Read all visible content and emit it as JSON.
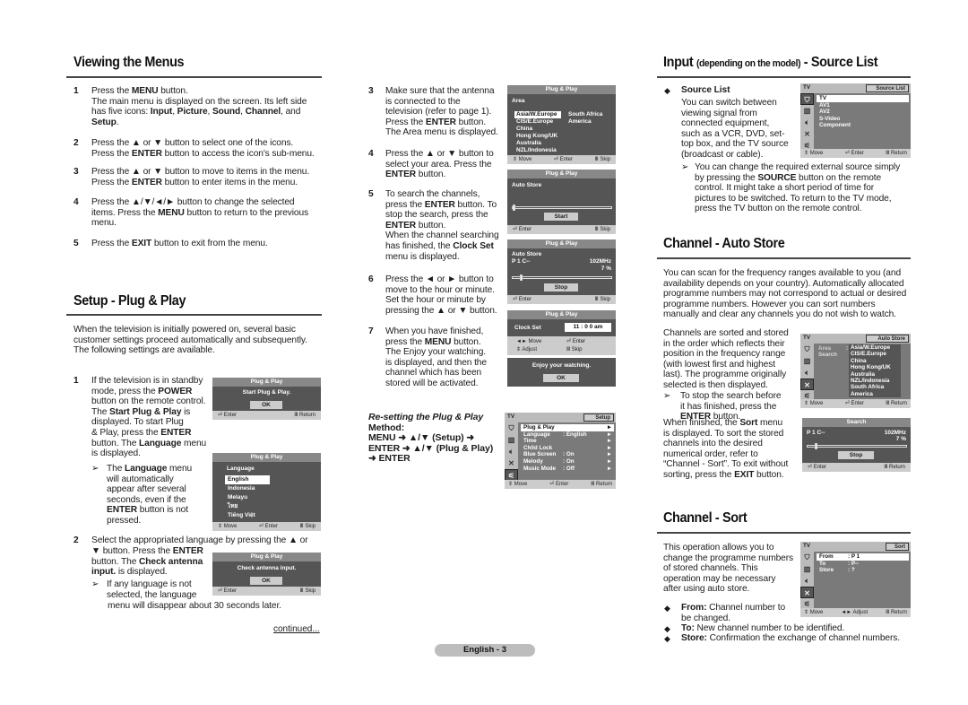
{
  "sections": {
    "viewing": {
      "title": "Viewing the Menus",
      "steps": [
        {
          "n": "1",
          "lines": [
            "Press the <b>MENU</b> button.",
            "The main menu is displayed on the screen. Its left side",
            "has five icons: <b>Input</b>, <b>Picture</b>, <b>Sound</b>, <b>Channel</b>, and",
            "<b>Setup</b>."
          ]
        },
        {
          "n": "2",
          "lines": [
            "Press the ▲ or ▼ button to select one of the icons.",
            "Press the <b>ENTER</b> button to access the icon's sub-menu."
          ]
        },
        {
          "n": "3",
          "lines": [
            "Press the ▲ or ▼ button to move to items in the menu.",
            "Press the <b>ENTER</b> button to enter items in the menu."
          ]
        },
        {
          "n": "4",
          "lines": [
            "Press the ▲/▼/◄/► button to change the selected",
            "items. Press the <b>MENU</b> button to return to the previous",
            "menu."
          ]
        },
        {
          "n": "5",
          "lines": [
            "Press the <b>EXIT</b> button to exit from the menu."
          ]
        }
      ]
    },
    "plug": {
      "title": "Setup - Plug & Play",
      "intro": [
        "When the television is initially powered on, several basic",
        "customer settings proceed automatically and subsequently.",
        "The following settings are available."
      ],
      "step1_num": "1",
      "step1": [
        "If the television is in standby",
        "mode, press the <b>POWER</b>",
        "button on the remote control.",
        "The <b>Start Plug &amp; Play</b> is",
        "displayed. To start Plug",
        "&amp; Play, press the <b>ENTER</b>",
        "button. The <b>Language</b> menu",
        "is displayed."
      ],
      "step1_note": [
        "The <b>Language</b> menu",
        "will automatically",
        "appear after several",
        "seconds, even if the",
        "<b>ENTER</b> button is not",
        "pressed."
      ],
      "step2_num": "2",
      "step2_first": "Select the appropriated language by pressing the ▲ or",
      "step2": [
        "▼ button. Press the <b>ENTER</b>",
        "button. The <b>Check antenna</b>",
        "<b>input.</b> is displayed."
      ],
      "step2_note": [
        "If any language is not",
        "selected, the language"
      ],
      "step2_tail": "menu will disappear about 30 seconds later.",
      "continued": "continued...",
      "step3_num": "3",
      "step3": [
        "Make sure that the antenna",
        "is connected to the",
        "television (refer to page 1).",
        "Press the <b>ENTER</b> button.",
        "The Area menu is displayed."
      ],
      "step4_num": "4",
      "step4": [
        "Press the ▲ or ▼ button to",
        "select your area. Press the",
        "<b>ENTER</b> button."
      ],
      "step5_num": "5",
      "step5": [
        "To search the channels,",
        "press the <b>ENTER</b> button. To",
        "stop the search, press the",
        "<b>ENTER</b> button.",
        "When the channel searching",
        "has finished, the <b>Clock Set</b>",
        "menu is displayed."
      ],
      "step6_num": "6",
      "step6": [
        "Press the ◄ or ► button to",
        "move to the hour or minute.",
        "Set the hour or minute by",
        "pressing the ▲ or ▼ button."
      ],
      "step7_num": "7",
      "step7": [
        "When you have finished,",
        "press the <b>MENU</b> button.",
        "The Enjoy your watching.",
        "is displayed, and then the",
        "channel which has been",
        "stored will be activated."
      ],
      "reset": [
        "<i>Re-setting the Plug &amp; Play</i>",
        "Method:",
        "MENU ➜ ▲/▼ (Setup) ➜",
        "ENTER ➜ ▲/▼ (Plug &amp; Play)",
        "➜ ENTER"
      ]
    },
    "source": {
      "title_main": "Input",
      "title_small": "(depending on the model)",
      "title_tail": "- Source List",
      "bullet_title": "Source List",
      "body": [
        "You can switch between",
        "viewing signal from",
        "connected equipment,",
        "such as a VCR, DVD, set-",
        "top box, and the TV source",
        "(broadcast or cable)."
      ],
      "note": [
        "You can change the required external source simply",
        "by pressing the <b>SOURCE</b> button on the remote",
        "control. It might take a short period of time for",
        "pictures to be switched. To return to the TV mode,",
        "press the TV button on the remote control."
      ]
    },
    "autostore": {
      "title": "Channel - Auto Store",
      "intro": [
        "You can scan for the frequency ranges available to you (and",
        "availability depends on your country). Automatically allocated",
        "programme numbers may not correspond to actual or desired",
        "programme numbers. However you can sort numbers",
        "manually and clear any channels you do not wish to watch."
      ],
      "body": [
        "Channels are sorted and stored",
        "in the order which reflects their",
        "position in the frequency range",
        "(with lowest first and highest",
        "last). The programme originally",
        "selected is then displayed."
      ],
      "note": [
        "To stop the search before",
        "it has finished, press the",
        "<b>ENTER</b> button."
      ],
      "tail": [
        "When finished, the <b>Sort</b> menu",
        "is displayed. To sort the stored",
        "channels into the desired",
        "numerical order, refer to",
        "“Channel - Sort”. To exit without",
        "sorting, press the <b>EXIT</b> button."
      ]
    },
    "sort": {
      "title": "Channel - Sort",
      "body": [
        "This operation allows you to",
        "change the programme numbers",
        "of stored channels. This",
        "operation may be necessary",
        "after using auto store."
      ],
      "bullets": [
        [
          "<b>From:</b> Channel number to",
          "be changed."
        ],
        [
          "<b>To:</b> New channel number to be identified."
        ],
        [
          "<b>Store:</b> Confirmation the exchange of channel numbers."
        ]
      ]
    }
  },
  "osd": {
    "start": {
      "title": "Plug & Play",
      "msg": "Start Plug & Play.",
      "ok": "OK",
      "foot_l": "⏎ Enter",
      "foot_r": "Ⅲ Return"
    },
    "language": {
      "title": "Plug & Play",
      "label": "Language",
      "items": [
        "English",
        "Indonesia",
        "Melayu",
        "ไทย",
        "Tiếng Việt"
      ],
      "selected": "English",
      "foot_l": "⇕ Move",
      "foot_m": "⏎ Enter",
      "foot_r": "Ⅲ Skip"
    },
    "antenna": {
      "title": "Plug & Play",
      "msg": "Check antenna input.",
      "ok": "OK",
      "foot_l": "⏎ Enter",
      "foot_r": "Ⅲ Skip"
    },
    "area": {
      "title": "Plug & Play",
      "label": "Area",
      "col1": [
        "Asia/W.Europe",
        "CIS/E.Europe",
        "China",
        "Hong Kong/UK",
        "Australia",
        "NZL/Indonesia"
      ],
      "col2": [
        "South Africa",
        "America"
      ],
      "foot_l": "⇕ Move",
      "foot_m": "⏎ Enter",
      "foot_r": "Ⅲ Skip"
    },
    "autostore_start": {
      "title": "Plug & Play",
      "label": "Auto Store",
      "button": "Start",
      "progress": 0,
      "foot_l": "⏎ Enter",
      "foot_r": "Ⅲ Skip"
    },
    "autostore_stop": {
      "title": "Plug & Play",
      "label": "Auto Store",
      "channel": "P 1 C--",
      "freq": "102MHz",
      "percent": "7 %",
      "progress": 7,
      "button": "Stop",
      "foot_l": "⏎ Enter",
      "foot_r": "Ⅲ Skip"
    },
    "clock": {
      "title": "Plug & Play",
      "label": "Clock Set",
      "value": "11 : 0 0  am",
      "f1": "◄► Move",
      "f2": "⏎ Enter",
      "f3": "⇕ Adjust",
      "f4": "Ⅲ Skip"
    },
    "enjoy": {
      "msg": "Enjoy your watching.",
      "ok": "OK"
    },
    "setup": {
      "tv": "TV",
      "title": "Setup",
      "rows": [
        {
          "label": "Plug & Play",
          "value": ""
        },
        {
          "label": "Language",
          "value": ": English"
        },
        {
          "label": "Time",
          "value": ""
        },
        {
          "label": "Child Lock",
          "value": ""
        },
        {
          "label": "Blue Screen",
          "value": ": On"
        },
        {
          "label": "Melody",
          "value": ": On"
        },
        {
          "label": "Music Mode",
          "value": ": Off"
        }
      ],
      "foot_l": "⇕ Move",
      "foot_m": "⏎ Enter",
      "foot_r": "Ⅲ Return"
    },
    "sourcelist": {
      "tv": "TV",
      "title": "Source List",
      "rows": [
        "TV",
        "AV1",
        "AV2",
        "S-Video",
        "Component"
      ],
      "foot_l": "⇕ Move",
      "foot_m": "⏎ Enter",
      "foot_r": "Ⅲ Return"
    },
    "autostore_menu": {
      "tv": "TV",
      "title": "Auto Store",
      "area_label": "Area",
      "search_label": "Search",
      "items": [
        "Asia/W.Europe",
        "CIS/E.Europe",
        "China",
        "Hong Kong/UK",
        "Australia",
        "NZL/Indonesia",
        "South Africa",
        "America"
      ],
      "foot_l": "⇕ Move",
      "foot_m": "⏎ Enter",
      "foot_r": "Ⅲ Return"
    },
    "search": {
      "title": "Search",
      "channel": "P 1 C--",
      "freq": "102MHz",
      "percent": "7 %",
      "progress": 7,
      "button": "Stop",
      "foot_l": "⏎ Enter",
      "foot_r": "Ⅲ Return"
    },
    "sort": {
      "tv": "TV",
      "title": "Sort",
      "rows": [
        {
          "label": "From",
          "value": ": P 1"
        },
        {
          "label": "To",
          "value": ": P--"
        },
        {
          "label": "Store",
          "value": ":  ?"
        }
      ],
      "foot_l": "⇕ Move",
      "foot_m": "◄► Adjust",
      "foot_r": "Ⅲ Return"
    }
  },
  "footer": {
    "page": "English - 3"
  }
}
